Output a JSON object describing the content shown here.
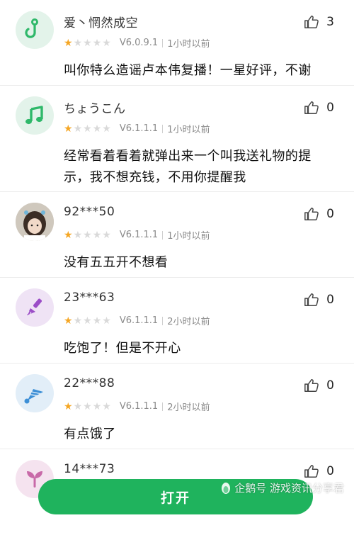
{
  "reviews": [
    {
      "name": "爱丶惘然成空",
      "version": "V6.0.9.1",
      "time": "1小时以前",
      "content": "叫你特么造谣卢本伟复播！一星好评，不谢",
      "likes": "3",
      "rating": 1,
      "avatar_icon": "hook-icon",
      "avatar_bg": "#e3f3ea",
      "avatar_fg": "#2fb86a"
    },
    {
      "name": "ちょうこん",
      "version": "V6.1.1.1",
      "time": "1小时以前",
      "content": "经常看着看着就弹出来一个叫我送礼物的提示，我不想充钱，不用你提醒我",
      "likes": "0",
      "rating": 1,
      "avatar_icon": "music-note-icon",
      "avatar_bg": "#e3f3ea",
      "avatar_fg": "#2fb86a"
    },
    {
      "name": "92***50",
      "version": "V6.1.1.1",
      "time": "1小时以前",
      "content": "没有五五开不想看",
      "likes": "0",
      "rating": 1,
      "avatar_icon": "photo-avatar",
      "avatar_bg": "#d9d4cc",
      "avatar_fg": "#4a3a30"
    },
    {
      "name": "23***63",
      "version": "V6.1.1.1",
      "time": "2小时以前",
      "content": "吃饱了！但是不开心",
      "likes": "0",
      "rating": 1,
      "avatar_icon": "brush-icon",
      "avatar_bg": "#efe3f5",
      "avatar_fg": "#9b4dc7"
    },
    {
      "name": "22***88",
      "version": "V6.1.1.1",
      "time": "2小时以前",
      "content": "有点饿了",
      "likes": "0",
      "rating": 1,
      "avatar_icon": "shuttlecock-icon",
      "avatar_bg": "#e2eef8",
      "avatar_fg": "#3d8fd6"
    },
    {
      "name": "14***73",
      "version": "",
      "time": "",
      "content": "",
      "likes": "0",
      "rating": 0,
      "avatar_icon": "sprout-icon",
      "avatar_bg": "#f5e3ef",
      "avatar_fg": "#c86aa8"
    }
  ],
  "open_button_label": "打开",
  "watermark_text": "企鹅号 游戏资讯分享君",
  "colors": {
    "accent_green": "#1fb35d",
    "star_on": "#f5a623",
    "star_off": "#d9d9d9"
  }
}
